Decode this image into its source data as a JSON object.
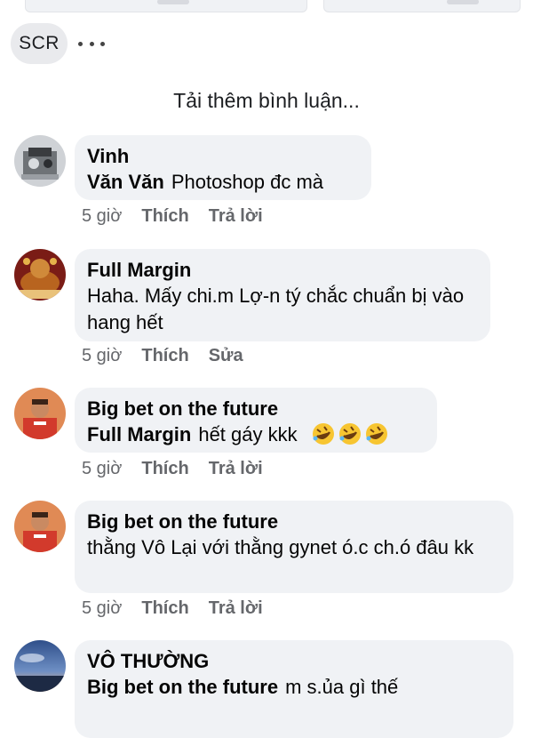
{
  "header": {
    "scr_label": "SCR",
    "more_icon": "ellipsis-icon"
  },
  "load_more": "Tải thêm bình luận...",
  "comments": [
    {
      "author": "Vinh",
      "mention": "Văn Văn",
      "text": "Photoshop đc mà",
      "time": "5 giờ",
      "like": "Thích",
      "action": "Trả lời"
    },
    {
      "author": "Full Margin",
      "text": "Haha. Mấy chi.m Lợ-n tý chắc chuẩn bị vào hang hết",
      "time": "5 giờ",
      "like": "Thích",
      "action": "Sửa"
    },
    {
      "author": "Big bet on the future",
      "mention": "Full Margin",
      "text": "hết gáy kkk",
      "emojis": [
        "rolling-laughing-emoji",
        "rolling-laughing-emoji",
        "rolling-laughing-emoji"
      ],
      "time": "5 giờ",
      "like": "Thích",
      "action": "Trả lời"
    },
    {
      "author": "Big bet on the future",
      "text": "thằng Vô Lại với thằng gynet ó.c ch.ó đâu kk",
      "time": "5 giờ",
      "like": "Thích",
      "action": "Trả lời"
    },
    {
      "author": "VÔ THƯỜNG",
      "mention": "Big bet on the future",
      "text": "m s.ủa gì thế"
    }
  ]
}
